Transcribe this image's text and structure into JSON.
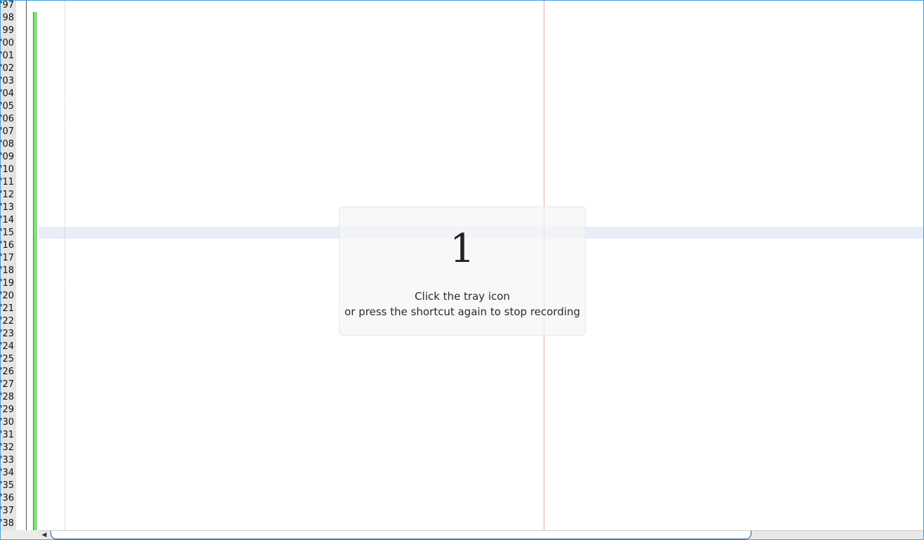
{
  "gutter": {
    "line_numbers": [
      "'97",
      "98",
      "99",
      "'00",
      "'01",
      "'02",
      "'03",
      "'04",
      "'05",
      "'06",
      "'07",
      "'08",
      "'09",
      "'10",
      "'11",
      "'12",
      "'13",
      "'14",
      "'15",
      "'16",
      "'17",
      "'18",
      "'19",
      "'20",
      "'21",
      "'22",
      "'23",
      "'24",
      "'25",
      "'26",
      "'27",
      "'28",
      "'29",
      "'30",
      "'31",
      "'32",
      "'33",
      "'34",
      "'35",
      "'36",
      "'37",
      "'38"
    ]
  },
  "recording_overlay": {
    "countdown": "1",
    "message_line1": "Click the tray icon",
    "message_line2": "or press the shortcut again to stop recording"
  },
  "scrollbar": {
    "left_arrow": "◀"
  },
  "colors": {
    "window_border": "#3aa3e3",
    "change_bar": "#84e07c",
    "current_line": "#e8eef8",
    "edge_line": "#f3a0a0"
  }
}
